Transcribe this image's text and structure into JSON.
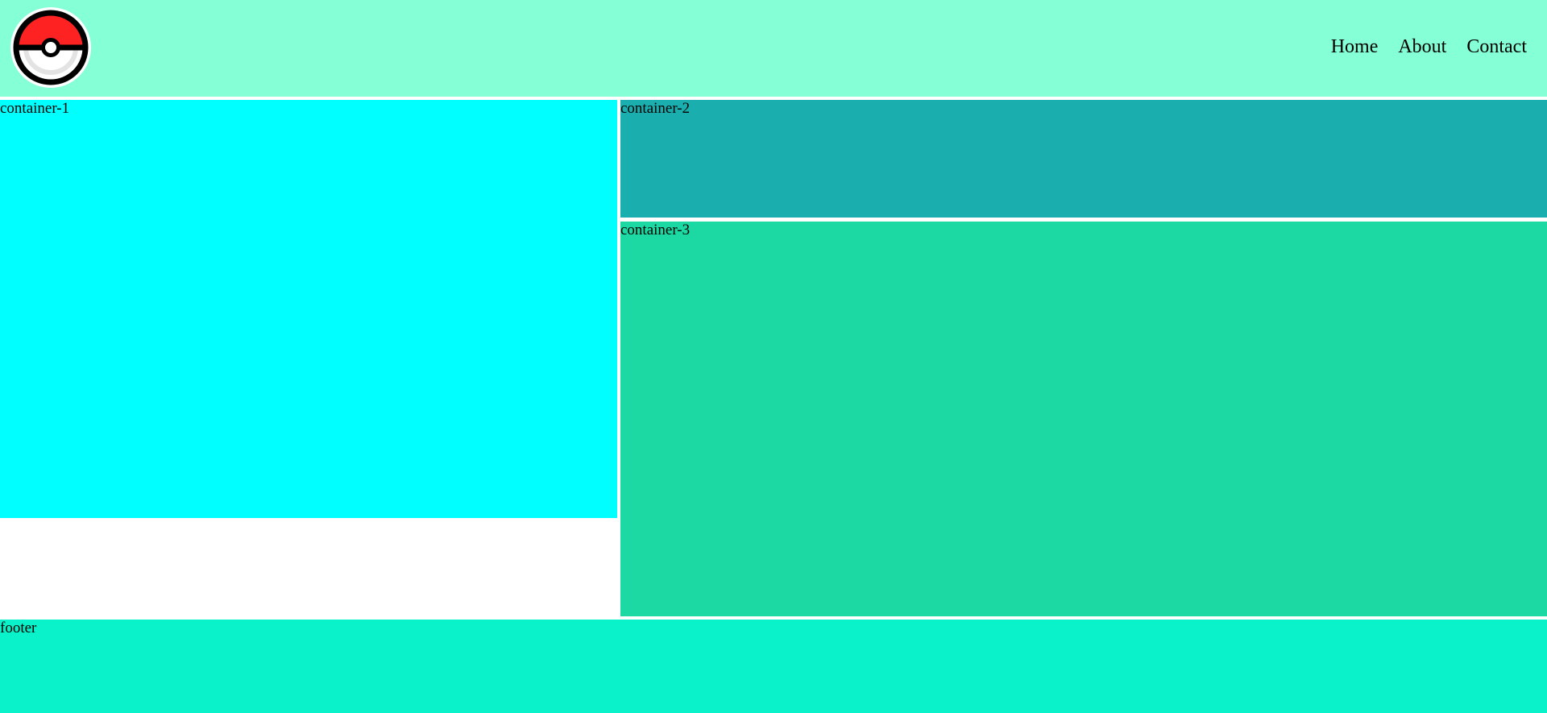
{
  "header": {
    "logo_icon": "pokeball-icon",
    "nav": [
      {
        "label": "Home"
      },
      {
        "label": "About"
      },
      {
        "label": "Contact"
      }
    ]
  },
  "containers": {
    "container_1": "container-1",
    "container_2": "container-2",
    "container_3": "container-3"
  },
  "footer": {
    "label": "footer"
  },
  "colors": {
    "header_bg": "#85ffd6",
    "container_1_bg": "#00ffff",
    "container_2_bg": "#1aaeae",
    "container_3_bg": "#1cd9a3",
    "footer_bg": "#0af2c9",
    "pokeball_red": "#ff2222"
  }
}
